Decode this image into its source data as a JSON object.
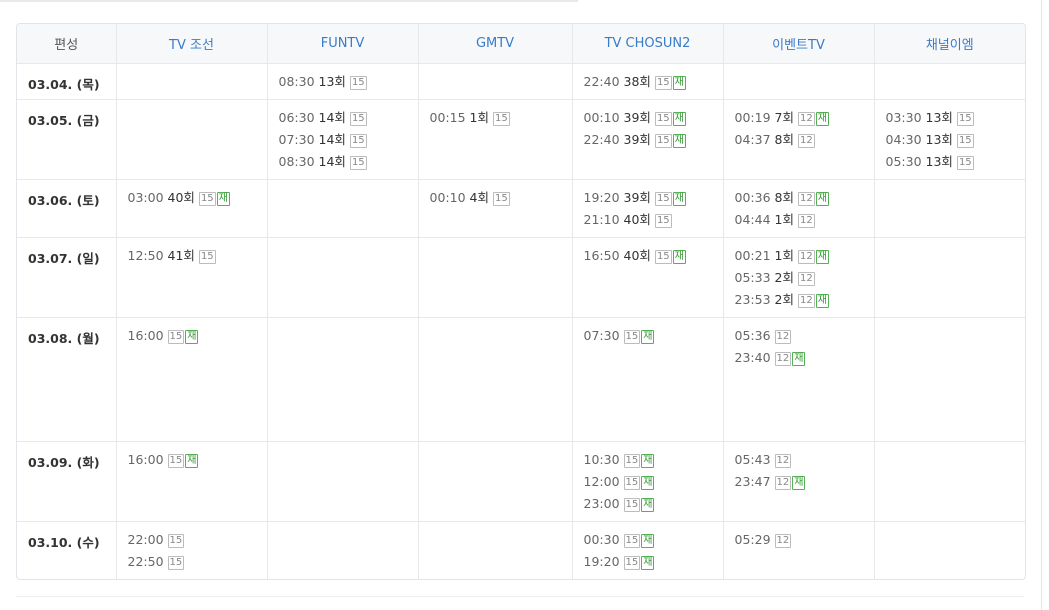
{
  "header": {
    "corner": "편성",
    "channels": [
      "TV 조선",
      "FUNTV",
      "GMTV",
      "TV CHOSUN2",
      "이벤트TV",
      "채널이엠"
    ]
  },
  "rows": [
    {
      "date": "03.04. (목)",
      "cells": [
        [],
        [
          {
            "time": "08:30",
            "episode": "13회",
            "rating": "15",
            "rerun": ""
          }
        ],
        [],
        [
          {
            "time": "22:40",
            "episode": "38회",
            "rating": "15",
            "rerun": "재"
          }
        ],
        [],
        []
      ]
    },
    {
      "date": "03.05. (금)",
      "cells": [
        [],
        [
          {
            "time": "06:30",
            "episode": "14회",
            "rating": "15",
            "rerun": ""
          },
          {
            "time": "07:30",
            "episode": "14회",
            "rating": "15",
            "rerun": ""
          },
          {
            "time": "08:30",
            "episode": "14회",
            "rating": "15",
            "rerun": ""
          }
        ],
        [
          {
            "time": "00:15",
            "episode": "1회",
            "rating": "15",
            "rerun": ""
          }
        ],
        [
          {
            "time": "00:10",
            "episode": "39회",
            "rating": "15",
            "rerun": "재"
          },
          {
            "time": "22:40",
            "episode": "39회",
            "rating": "15",
            "rerun": "재"
          }
        ],
        [
          {
            "time": "00:19",
            "episode": "7회",
            "rating": "12",
            "rerun": "재"
          },
          {
            "time": "04:37",
            "episode": "8회",
            "rating": "12",
            "rerun": ""
          }
        ],
        [
          {
            "time": "03:30",
            "episode": "13회",
            "rating": "15",
            "rerun": ""
          },
          {
            "time": "04:30",
            "episode": "13회",
            "rating": "15",
            "rerun": ""
          },
          {
            "time": "05:30",
            "episode": "13회",
            "rating": "15",
            "rerun": ""
          }
        ]
      ]
    },
    {
      "date": "03.06. (토)",
      "cells": [
        [
          {
            "time": "03:00",
            "episode": "40회",
            "rating": "15",
            "rerun": "재"
          }
        ],
        [],
        [
          {
            "time": "00:10",
            "episode": "4회",
            "rating": "15",
            "rerun": ""
          }
        ],
        [
          {
            "time": "19:20",
            "episode": "39회",
            "rating": "15",
            "rerun": "재"
          },
          {
            "time": "21:10",
            "episode": "40회",
            "rating": "15",
            "rerun": ""
          }
        ],
        [
          {
            "time": "00:36",
            "episode": "8회",
            "rating": "12",
            "rerun": "재"
          },
          {
            "time": "04:44",
            "episode": "1회",
            "rating": "12",
            "rerun": ""
          }
        ],
        []
      ]
    },
    {
      "date": "03.07. (일)",
      "cells": [
        [
          {
            "time": "12:50",
            "episode": "41회",
            "rating": "15",
            "rerun": ""
          }
        ],
        [],
        [],
        [
          {
            "time": "16:50",
            "episode": "40회",
            "rating": "15",
            "rerun": "재"
          }
        ],
        [
          {
            "time": "00:21",
            "episode": "1회",
            "rating": "12",
            "rerun": "재"
          },
          {
            "time": "05:33",
            "episode": "2회",
            "rating": "12",
            "rerun": ""
          },
          {
            "time": "23:53",
            "episode": "2회",
            "rating": "12",
            "rerun": "재"
          }
        ],
        []
      ]
    },
    {
      "date": "03.08. (월)",
      "cells": [
        [
          {
            "time": "16:00",
            "episode": "",
            "rating": "15",
            "rerun": "재"
          }
        ],
        [],
        [],
        [
          {
            "time": "07:30",
            "episode": "",
            "rating": "15",
            "rerun": "재"
          }
        ],
        [
          {
            "time": "05:36",
            "episode": "",
            "rating": "12",
            "rerun": ""
          },
          {
            "time": "23:40",
            "episode": "",
            "rating": "12",
            "rerun": "재"
          }
        ],
        []
      ]
    },
    {
      "date": "03.09. (화)",
      "cells": [
        [
          {
            "time": "16:00",
            "episode": "",
            "rating": "15",
            "rerun": "재"
          }
        ],
        [],
        [],
        [
          {
            "time": "10:30",
            "episode": "",
            "rating": "15",
            "rerun": "재"
          },
          {
            "time": "12:00",
            "episode": "",
            "rating": "15",
            "rerun": "재"
          },
          {
            "time": "23:00",
            "episode": "",
            "rating": "15",
            "rerun": "재"
          }
        ],
        [
          {
            "time": "05:43",
            "episode": "",
            "rating": "12",
            "rerun": ""
          },
          {
            "time": "23:47",
            "episode": "",
            "rating": "12",
            "rerun": "재"
          }
        ],
        []
      ]
    },
    {
      "date": "03.10. (수)",
      "cells": [
        [
          {
            "time": "22:00",
            "episode": "",
            "rating": "15",
            "rerun": ""
          },
          {
            "time": "22:50",
            "episode": "",
            "rating": "15",
            "rerun": ""
          }
        ],
        [],
        [],
        [
          {
            "time": "00:30",
            "episode": "",
            "rating": "15",
            "rerun": "재"
          },
          {
            "time": "19:20",
            "episode": "",
            "rating": "15",
            "rerun": "재"
          }
        ],
        [
          {
            "time": "05:29",
            "episode": "",
            "rating": "12",
            "rerun": ""
          }
        ],
        []
      ]
    }
  ],
  "colors": {
    "header_text": "#3a7bc8",
    "header_bg": "#f6f8fa",
    "rerun_badge": "#54b254",
    "rating_badge": "#bcbcbc",
    "border": "#e6e8eb"
  }
}
